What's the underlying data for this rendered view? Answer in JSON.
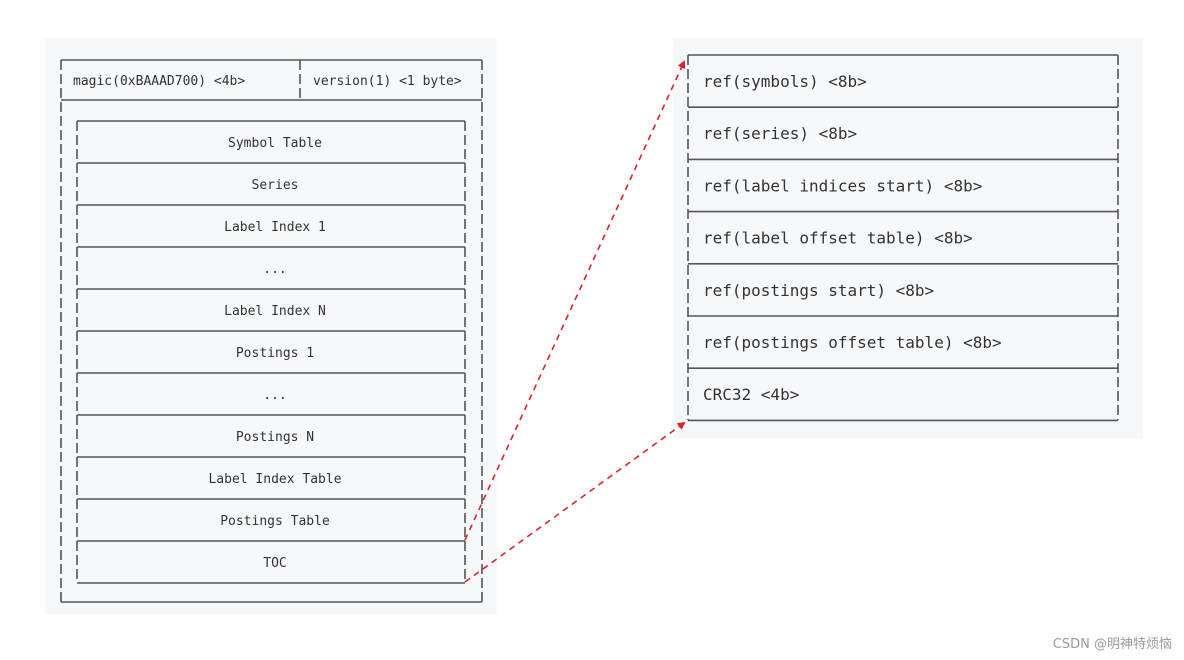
{
  "left_block": {
    "header": {
      "magic": "magic(0xBAAAD700) <4b>",
      "version": "version(1) <1 byte>"
    },
    "sections": [
      "Symbol Table",
      "Series",
      "Label Index 1",
      "...",
      "Label Index N",
      "Postings 1",
      "...",
      "Postings N",
      "Label Index Table",
      "Postings Table",
      "TOC"
    ]
  },
  "toc_block": {
    "entries": [
      "ref(symbols) <8b>",
      "ref(series) <8b>",
      "ref(label indices start) <8b>",
      "ref(label offset table) <8b>",
      "ref(postings start) <8b>",
      "ref(postings offset table) <8b>",
      "CRC32 <4b>"
    ]
  },
  "arrow_color": "#d9232e",
  "watermark": "CSDN @明神特烦恼"
}
